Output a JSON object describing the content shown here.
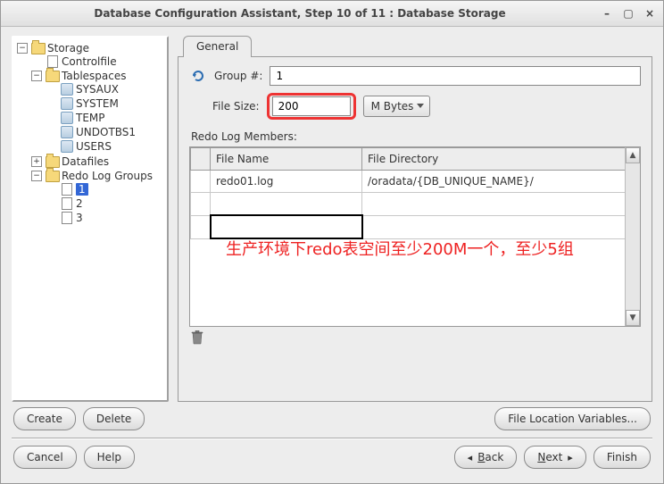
{
  "window": {
    "title": "Database Configuration Assistant, Step 10 of 11 : Database Storage"
  },
  "tree": {
    "root": "Storage",
    "controlfile": "Controlfile",
    "tablespaces": {
      "label": "Tablespaces",
      "items": [
        "SYSAUX",
        "SYSTEM",
        "TEMP",
        "UNDOTBS1",
        "USERS"
      ]
    },
    "datafiles": "Datafiles",
    "redogroups": {
      "label": "Redo Log Groups",
      "items": [
        "1",
        "2",
        "3"
      ],
      "selected_index": 0
    }
  },
  "tab": {
    "label": "General"
  },
  "form": {
    "group_label": "Group #:",
    "group_value": "1",
    "filesize_label": "File Size:",
    "filesize_value": "200",
    "filesize_unit": "M Bytes",
    "members_label": "Redo Log Members:"
  },
  "table": {
    "headers": {
      "filename": "File Name",
      "filedir": "File Directory"
    },
    "rows": [
      {
        "filename": "redo01.log",
        "filedir": "/oradata/{DB_UNIQUE_NAME}/"
      },
      {
        "filename": "",
        "filedir": ""
      },
      {
        "filename": "",
        "filedir": ""
      }
    ]
  },
  "annotation": "生产环境下redo表空间至少200M一个，至少5组",
  "buttons": {
    "create": "Create",
    "delete": "Delete",
    "file_loc": "File Location Variables...",
    "cancel": "Cancel",
    "help": "Help",
    "back": "Back",
    "next": "Next",
    "finish": "Finish"
  }
}
